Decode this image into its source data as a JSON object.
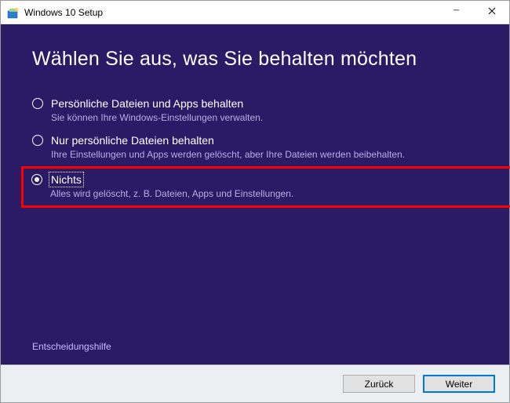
{
  "window": {
    "title": "Windows 10 Setup",
    "minimize_icon": "—",
    "close_icon": "✕"
  },
  "main": {
    "heading": "Wählen Sie aus, was Sie behalten möchten",
    "options": [
      {
        "label": "Persönliche Dateien und Apps behalten",
        "description": "Sie können Ihre Windows-Einstellungen verwalten.",
        "selected": false
      },
      {
        "label": "Nur persönliche Dateien behalten",
        "description": "Ihre Einstellungen und Apps werden gelöscht, aber Ihre Dateien werden beibehalten.",
        "selected": false
      },
      {
        "label": "Nichts",
        "description": "Alles wird gelöscht, z. B. Dateien, Apps und Einstellungen.",
        "selected": true
      }
    ],
    "help_link": "Entscheidungshilfe"
  },
  "footer": {
    "back": "Zurück",
    "next": "Weiter"
  },
  "colors": {
    "background": "#2b1a66",
    "highlight_border": "#ff0000",
    "desc_text": "#b9aee0",
    "primary_border": "#0078d7"
  }
}
